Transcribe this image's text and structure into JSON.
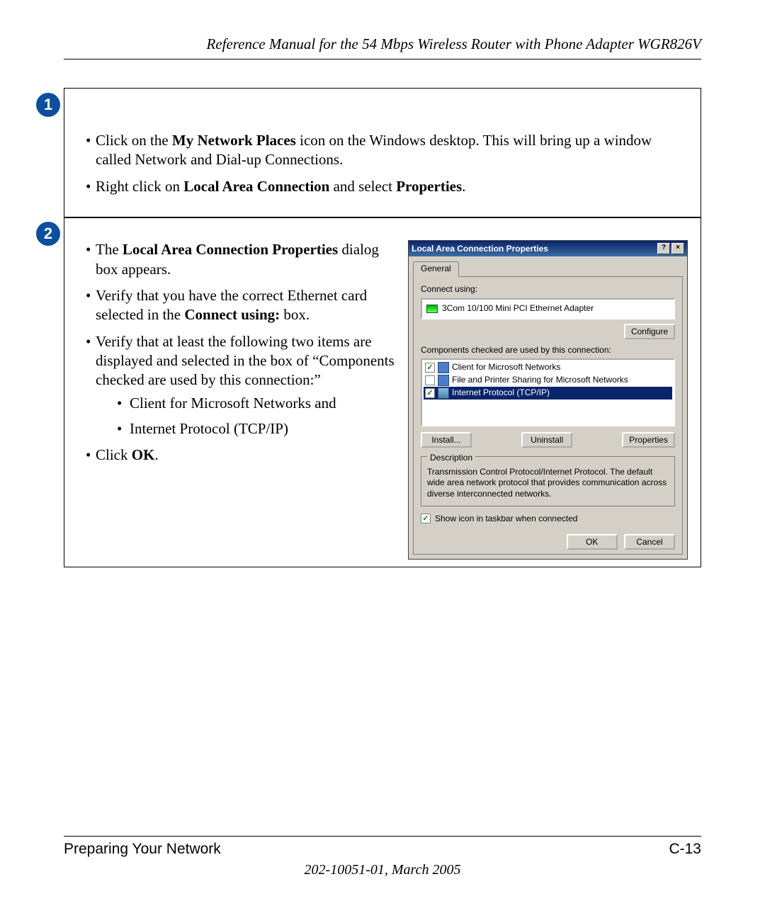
{
  "header": {
    "title": "Reference Manual for the 54 Mbps Wireless Router with Phone Adapter WGR826V"
  },
  "step1": {
    "number": "1",
    "bullet1_pre": "Click on the ",
    "bullet1_bold": "My Network Places",
    "bullet1_post": " icon on the Windows desktop.  This will bring up a window called Network and Dial-up Connections.",
    "bullet2_pre": "Right click on ",
    "bullet2_bold1": "Local Area Connection",
    "bullet2_mid": " and select ",
    "bullet2_bold2": "Properties",
    "bullet2_post": "."
  },
  "step2": {
    "number": "2",
    "b1_pre": "The ",
    "b1_bold": "Local Area Connection Properties",
    "b1_post": " dialog box appears.",
    "b2_pre": "Verify that you have the correct Ethernet card selected in the ",
    "b2_bold": "Connect using:",
    "b2_post": " box.",
    "b3": "Verify that at least the following two items are displayed and selected in the box of “Components checked are used by this connection:”",
    "b3_sub1": "Client for Microsoft Networks and",
    "b3_sub2": "Internet Protocol (TCP/IP)",
    "b4_pre": "Click ",
    "b4_bold": "OK",
    "b4_post": "."
  },
  "dialog": {
    "title": "Local Area Connection Properties",
    "help_btn": "?",
    "close_btn": "×",
    "tab": "General",
    "connect_using_label": "Connect using:",
    "nic": "3Com 10/100 Mini PCI Ethernet Adapter",
    "configure_btn": "Configure",
    "components_label": "Components checked are used by this connection:",
    "item1": "Client for Microsoft Networks",
    "item2": "File and Printer Sharing for Microsoft Networks",
    "item3": "Internet Protocol (TCP/IP)",
    "install_btn": "Install...",
    "uninstall_btn": "Uninstall",
    "properties_btn": "Properties",
    "desc_legend": "Description",
    "desc_text": "Transmission Control Protocol/Internet Protocol. The default wide area network protocol that provides communication across diverse interconnected networks.",
    "show_icon_label": "Show icon in taskbar when connected",
    "ok_btn": "OK",
    "cancel_btn": "Cancel"
  },
  "footer": {
    "left": "Preparing Your Network",
    "right": "C-13",
    "date": "202-10051-01, March 2005"
  }
}
